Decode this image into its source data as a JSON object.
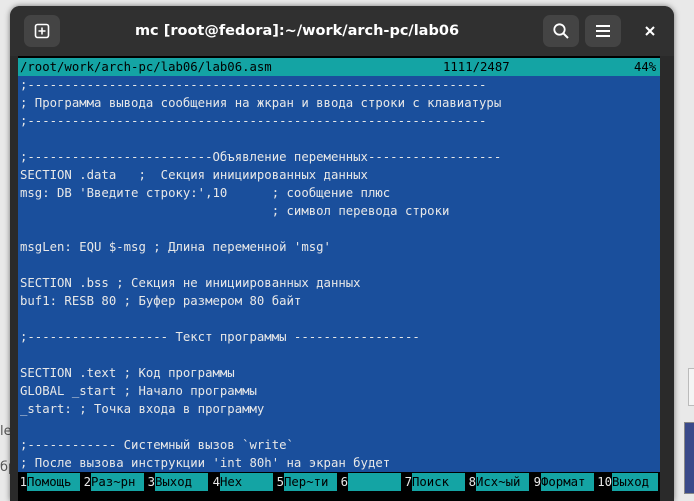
{
  "window": {
    "title": "mc [root@fedora]:~/work/arch-pc/lab06",
    "icons": [
      "new-tab-icon",
      "search-icon",
      "hamburger-menu-icon",
      "close-icon"
    ]
  },
  "background": {
    "text_fragments": [
      "le",
      "бр"
    ]
  },
  "editor": {
    "status": {
      "path": "/root/work/arch-pc/lab06/lab06.asm",
      "position": "1111/2487",
      "percent": "44%"
    },
    "lines": [
      ";--------------------------------------------------------------",
      "; Программа вывода сообщения на жкран и ввода строки с клавиатуры",
      ";--------------------------------------------------------------",
      "",
      ";-------------------------Объявление переменных------------------",
      "SECTION .data   ;  Секция инициированных данных",
      "msg: DB 'Введите строку:',10      ; сообщение плюс",
      "                                  ; символ перевода строки",
      "",
      "msgLen: EQU $-msg ; Длина переменной 'msg'",
      "",
      "SECTION .bss ; Секция не инициированных данных",
      "buf1: RESB 80 ; Буфер размером 80 байт",
      "",
      ";------------------- Текст программы -----------------",
      "",
      "SECTION .text ; Код программы",
      "GLOBAL _start ; Начало программы",
      "_start: ; Точка входа в программу",
      "",
      ";------------ Системный вызов `write`",
      "; После вызова инструкции 'int 80h' на экран будет"
    ]
  },
  "function_keys": [
    {
      "num": "1",
      "label": "Помощь"
    },
    {
      "num": "2",
      "label": "Раз~рн"
    },
    {
      "num": "3",
      "label": "Выход"
    },
    {
      "num": "4",
      "label": "Нех"
    },
    {
      "num": "5",
      "label": "Пер~ти"
    },
    {
      "num": "6",
      "label": ""
    },
    {
      "num": "7",
      "label": "Поиск"
    },
    {
      "num": "8",
      "label": "Исх~ый"
    },
    {
      "num": "9",
      "label": "Формат"
    },
    {
      "num": "10",
      "label": "Выход"
    }
  ],
  "colors": {
    "editor_bg": "#1a4f9c",
    "status_bg": "#14a4a4",
    "titlebar_bg": "#303030"
  }
}
